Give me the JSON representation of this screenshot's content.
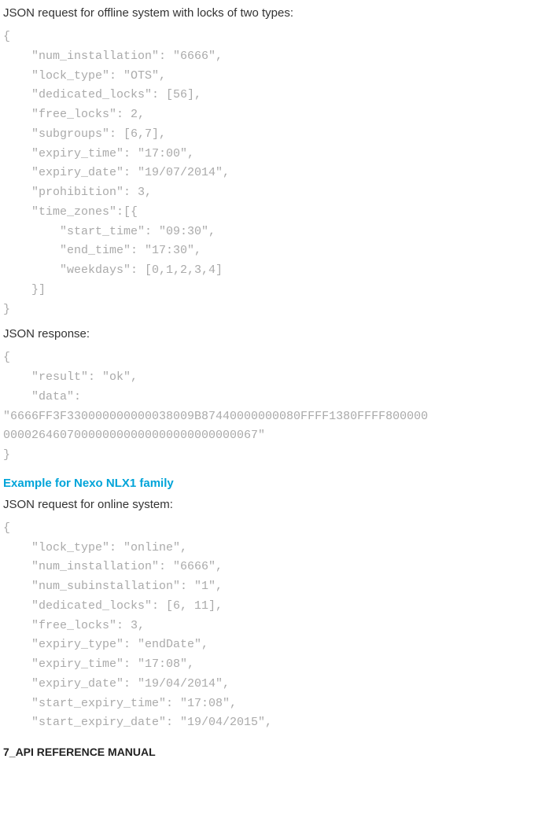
{
  "p1": "JSON request for offline system with locks of two types:",
  "code1": "{\n    \"num_installation\": \"6666\",\n    \"lock_type\": \"OTS\",\n    \"dedicated_locks\": [56],\n    \"free_locks\": 2,\n    \"subgroups\": [6,7],\n    \"expiry_time\": \"17:00\",\n    \"expiry_date\": \"19/07/2014\",\n    \"prohibition\": 3,\n    \"time_zones\":[{\n        \"start_time\": \"09:30\",\n        \"end_time\": \"17:30\",\n        \"weekdays\": [0,1,2,3,4]\n    }]\n}",
  "p2": "JSON response:",
  "code2": "{\n    \"result\": \"ok\",\n    \"data\": \n\"6666FF3F330000000000038009B87440000000080FFFF1380FFFF800000\n000026460700000000000000000000000067\"\n}",
  "heading1": "Example for Nexo NLX1 family",
  "p3": "JSON request for online system:",
  "code3": "{\n    \"lock_type\": \"online\",\n    \"num_installation\": \"6666\",\n    \"num_subinstallation\": \"1\",\n    \"dedicated_locks\": [6, 11],\n    \"free_locks\": 3,\n    \"expiry_type\": \"endDate\",\n    \"expiry_time\": \"17:08\",\n    \"expiry_date\": \"19/04/2014\",\n    \"start_expiry_time\": \"17:08\",\n    \"start_expiry_date\": \"19/04/2015\",",
  "footer": "7_API REFERENCE MANUAL"
}
